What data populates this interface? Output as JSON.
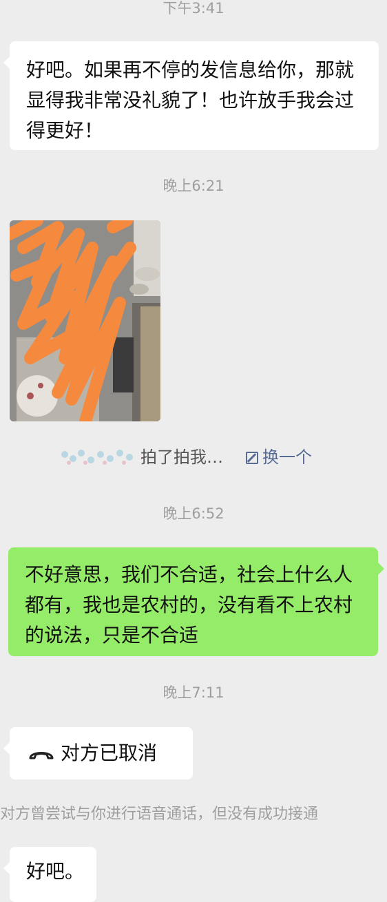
{
  "messages": {
    "ts1": "下午3:41",
    "msg1": "好吧。如果再不停的发信息给你，那就显得我非常没礼貌了！也许放手我会过得更好！",
    "ts2": "晚上6:21",
    "pat_action": "拍了拍我…",
    "pat_change": "换一个",
    "ts3": "晚上6:52",
    "msg2": "不好意思，我们不合适，社会上什么人都有，我也是农村的，没有看不上农村的说法，只是不合适",
    "ts4": "晚上7:11",
    "call_status": "对方已取消",
    "call_note": "对方曾尝试与你进行语音通话，但没有成功接通",
    "msg3": "好吧。"
  },
  "colors": {
    "background": "#ededed",
    "incoming_bubble": "#ffffff",
    "outgoing_bubble": "#95ec69",
    "link": "#576b95",
    "scribble": "#f58a3e"
  },
  "icons": {
    "call": "phone-hangup-icon",
    "edit": "edit-icon"
  }
}
